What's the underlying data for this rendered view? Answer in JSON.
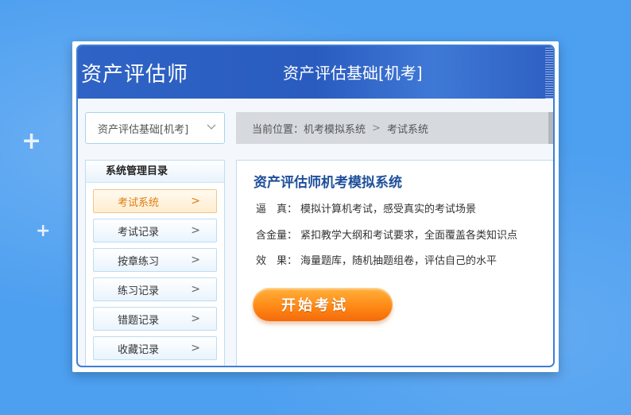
{
  "header": {
    "app_title": "资产评估师",
    "exam_title": "资产评估基础[机考]"
  },
  "subject_select": {
    "selected": "资产评估基础[机考]",
    "chevron_icon": "chevron-down-icon"
  },
  "breadcrumb": {
    "prefix": "当前位置：",
    "items": [
      "机考模拟系统",
      "考试系统"
    ],
    "separator": ">"
  },
  "sidebar": {
    "title": "系统管理目录",
    "items": [
      {
        "label": "考试系统",
        "active": true
      },
      {
        "label": "考试记录",
        "active": false
      },
      {
        "label": "按章练习",
        "active": false
      },
      {
        "label": "练习记录",
        "active": false
      },
      {
        "label": "错题记录",
        "active": false
      },
      {
        "label": "收藏记录",
        "active": false
      }
    ],
    "arrow": ">"
  },
  "content": {
    "title": "资产评估师机考模拟系统",
    "features": [
      {
        "label": "逼　真：",
        "text": "模拟计算机考试，感受真实的考试场景"
      },
      {
        "label": "含金量：",
        "text": "紧扣教学大纲和考试要求，全面覆盖各类知识点"
      },
      {
        "label": "效　果：",
        "text": "海量题库，随机抽题组卷，评估自己的水平"
      }
    ],
    "start_button": "开始考试"
  },
  "colors": {
    "header_blue": "#2f63c5",
    "active_orange": "#e17c12",
    "button_orange": "#ff8a16",
    "title_blue": "#1f4f9a"
  }
}
